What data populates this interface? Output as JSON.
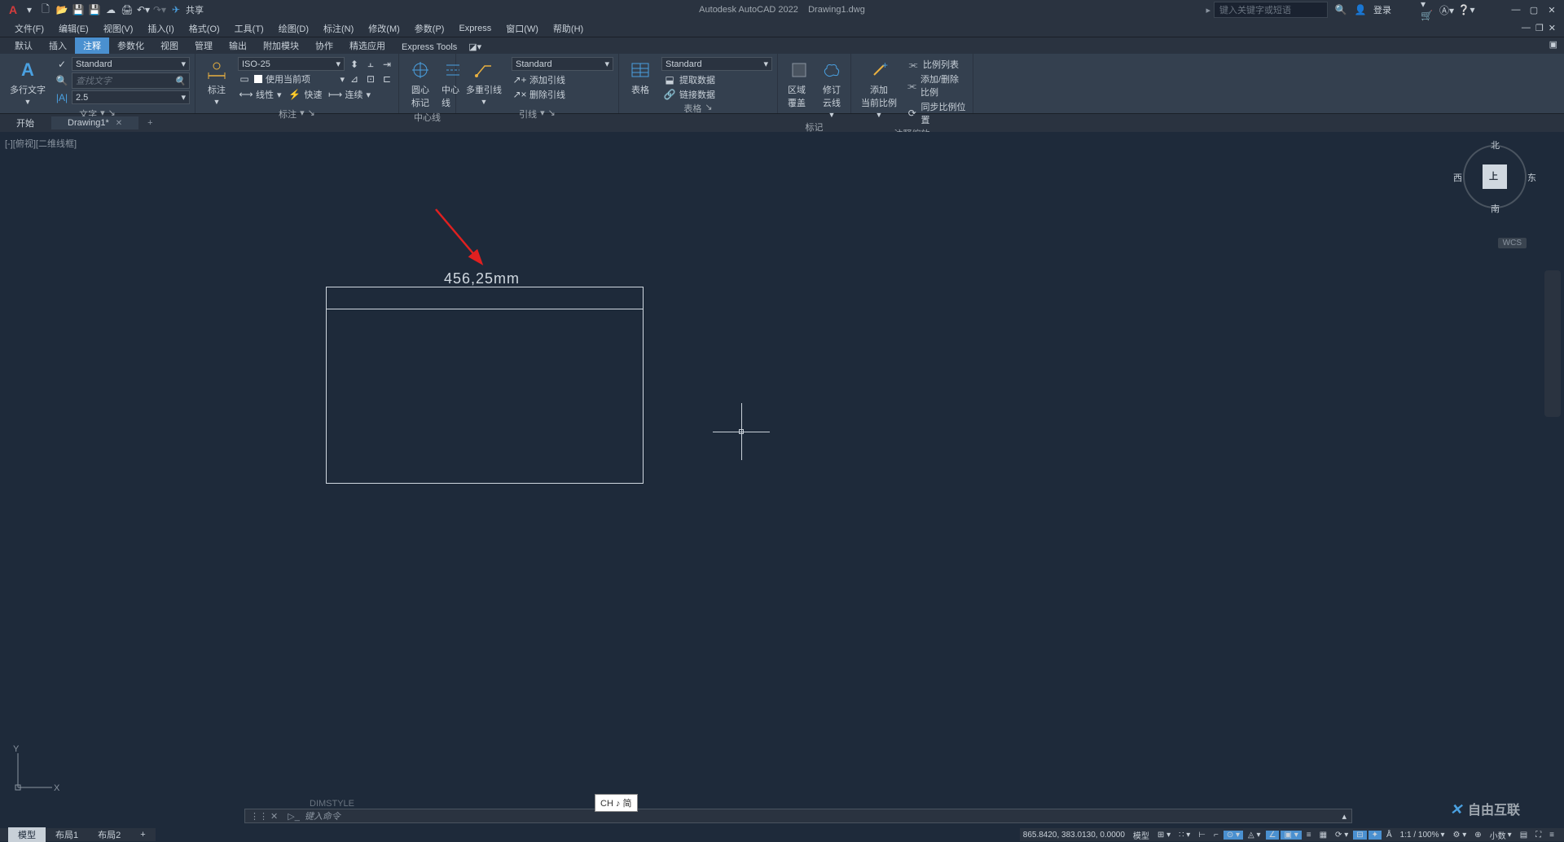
{
  "titlebar": {
    "app_title": "Autodesk AutoCAD 2022",
    "doc_title": "Drawing1.dwg",
    "share_label": "共享",
    "search_placeholder": "键入关键字或短语",
    "login_label": "登录"
  },
  "menubar": {
    "items": [
      "文件(F)",
      "编辑(E)",
      "视图(V)",
      "插入(I)",
      "格式(O)",
      "工具(T)",
      "绘图(D)",
      "标注(N)",
      "修改(M)",
      "参数(P)",
      "Express",
      "窗口(W)",
      "帮助(H)"
    ]
  },
  "ribbon_tabs": {
    "items": [
      "默认",
      "插入",
      "注释",
      "参数化",
      "视图",
      "管理",
      "输出",
      "附加模块",
      "协作",
      "精选应用",
      "Express Tools"
    ],
    "active_index": 2
  },
  "ribbon": {
    "text_panel": {
      "title": "文字",
      "mtext_label": "多行文字",
      "style": "Standard",
      "find_placeholder": "查找文字",
      "height": "2.5"
    },
    "dim_panel": {
      "title": "标注",
      "dim_label": "标注",
      "style": "ISO-25",
      "current_label": "使用当前项",
      "linear": "线性",
      "quick": "快速",
      "continue": "连续"
    },
    "centerline_panel": {
      "title": "中心线",
      "center_mark": "圆心\n标记",
      "centerline": "中心线"
    },
    "leader_panel": {
      "title": "引线",
      "multileader": "多重引线",
      "style": "Standard",
      "add": "添加引线",
      "remove": "删除引线"
    },
    "table_panel": {
      "title": "表格",
      "table_label": "表格",
      "style": "Standard",
      "extract": "提取数据",
      "link": "链接数据"
    },
    "markup_panel": {
      "title": "标记",
      "wipeout": "区域覆盖",
      "revcloud": "修订\n云线"
    },
    "scale_panel": {
      "title": "注释缩放",
      "add_current": "添加\n当前比例",
      "scale_list": "比例列表",
      "add_del": "添加/删除比例",
      "sync": "同步比例位置"
    }
  },
  "file_tabs": {
    "start": "开始",
    "drawing": "Drawing1*"
  },
  "canvas": {
    "view_label": "[-][俯视][二维线框]",
    "dimension_text": "456,25mm",
    "wcs": "WCS",
    "compass": {
      "n": "北",
      "s": "南",
      "e": "东",
      "w": "西",
      "top": "上"
    }
  },
  "command": {
    "history": "DIMSTYLE",
    "prompt_prefix": "键入命令"
  },
  "ime": {
    "text": "CH ♪ 简"
  },
  "layout_tabs": {
    "items": [
      "模型",
      "布局1",
      "布局2"
    ],
    "active_index": 0
  },
  "statusbar": {
    "coords": "865.8420, 383.0130, 0.0000",
    "model": "模型",
    "scale": "1:1 / 100%",
    "decimal": "小数"
  },
  "watermark": {
    "text": "自由互联"
  }
}
